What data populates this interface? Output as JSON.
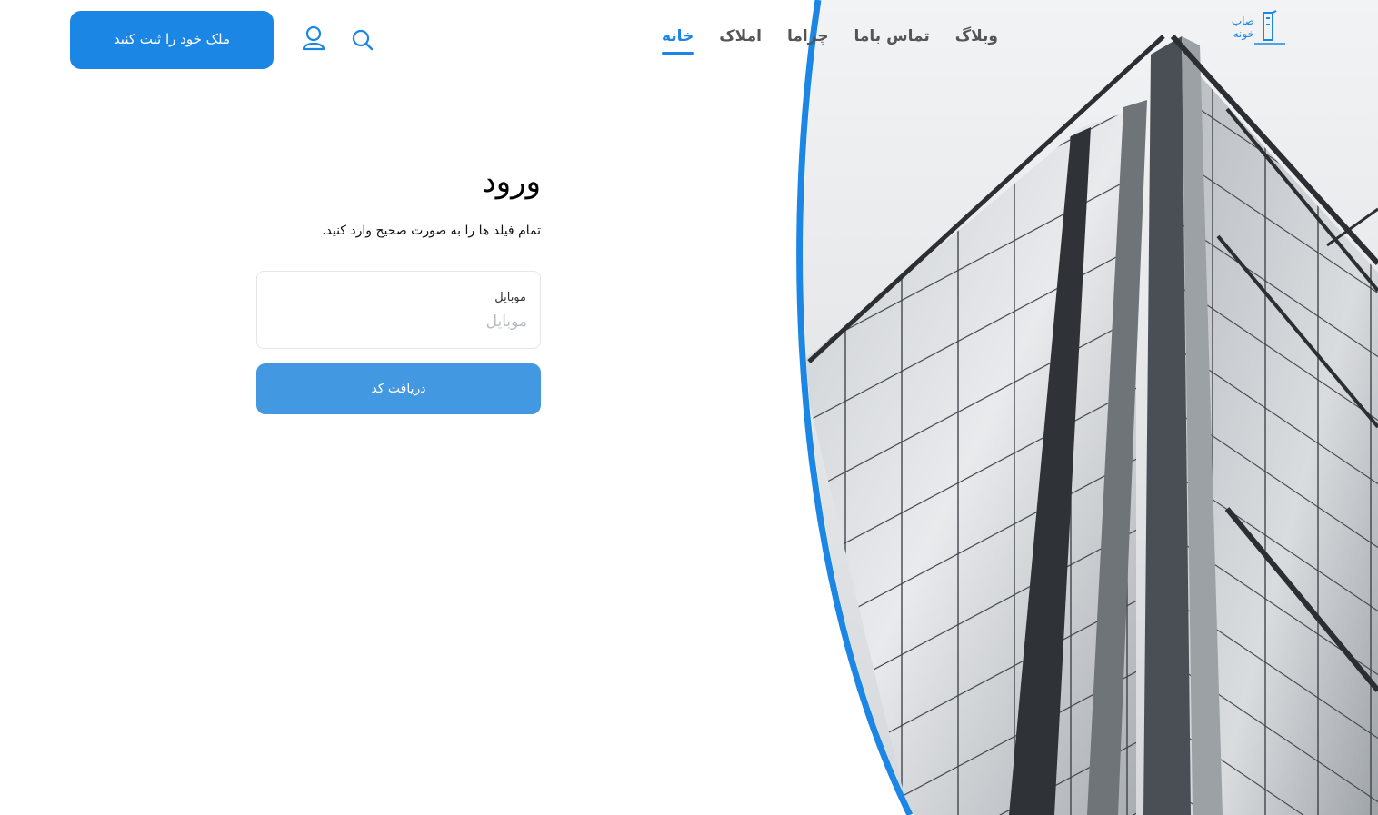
{
  "brand": {
    "logo_text_line1": "صاب",
    "logo_text_line2": "خونه",
    "accent_color": "#1b86e3"
  },
  "nav": {
    "items": [
      {
        "label": "خانه",
        "active": true
      },
      {
        "label": "املاک",
        "active": false
      },
      {
        "label": "چراما",
        "active": false
      },
      {
        "label": "تماس باما",
        "active": false
      },
      {
        "label": "وبلاگ",
        "active": false
      }
    ]
  },
  "header": {
    "search_icon": "search-icon",
    "user_icon": "user-icon",
    "register_label": "ملک خود را ثبت کنید"
  },
  "login": {
    "title": "ورود",
    "subtitle": "تمام فیلد ها را به صورت صحیح وارد کنید.",
    "mobile_label": "موبایل",
    "mobile_placeholder": "موبایل",
    "mobile_value": "",
    "submit_label": "دریافت کد"
  },
  "hero": {
    "image": "glass-office-building"
  }
}
